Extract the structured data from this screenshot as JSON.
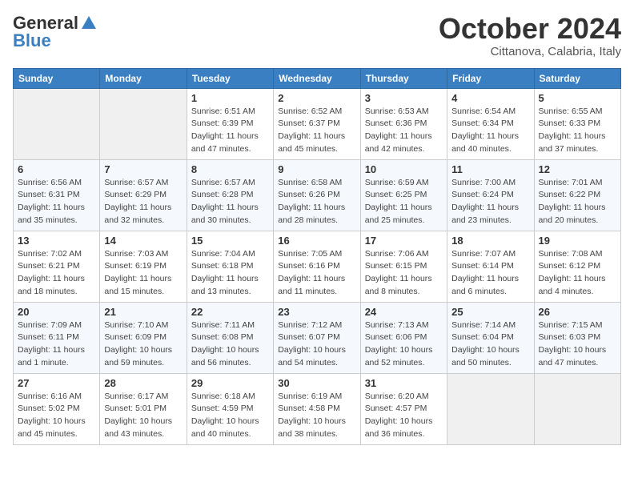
{
  "logo": {
    "general": "General",
    "blue": "Blue"
  },
  "title": "October 2024",
  "location": "Cittanova, Calabria, Italy",
  "weekdays": [
    "Sunday",
    "Monday",
    "Tuesday",
    "Wednesday",
    "Thursday",
    "Friday",
    "Saturday"
  ],
  "weeks": [
    [
      {
        "day": "",
        "sunrise": "",
        "sunset": "",
        "daylight": ""
      },
      {
        "day": "",
        "sunrise": "",
        "sunset": "",
        "daylight": ""
      },
      {
        "day": "1",
        "sunrise": "Sunrise: 6:51 AM",
        "sunset": "Sunset: 6:39 PM",
        "daylight": "Daylight: 11 hours and 47 minutes."
      },
      {
        "day": "2",
        "sunrise": "Sunrise: 6:52 AM",
        "sunset": "Sunset: 6:37 PM",
        "daylight": "Daylight: 11 hours and 45 minutes."
      },
      {
        "day": "3",
        "sunrise": "Sunrise: 6:53 AM",
        "sunset": "Sunset: 6:36 PM",
        "daylight": "Daylight: 11 hours and 42 minutes."
      },
      {
        "day": "4",
        "sunrise": "Sunrise: 6:54 AM",
        "sunset": "Sunset: 6:34 PM",
        "daylight": "Daylight: 11 hours and 40 minutes."
      },
      {
        "day": "5",
        "sunrise": "Sunrise: 6:55 AM",
        "sunset": "Sunset: 6:33 PM",
        "daylight": "Daylight: 11 hours and 37 minutes."
      }
    ],
    [
      {
        "day": "6",
        "sunrise": "Sunrise: 6:56 AM",
        "sunset": "Sunset: 6:31 PM",
        "daylight": "Daylight: 11 hours and 35 minutes."
      },
      {
        "day": "7",
        "sunrise": "Sunrise: 6:57 AM",
        "sunset": "Sunset: 6:29 PM",
        "daylight": "Daylight: 11 hours and 32 minutes."
      },
      {
        "day": "8",
        "sunrise": "Sunrise: 6:57 AM",
        "sunset": "Sunset: 6:28 PM",
        "daylight": "Daylight: 11 hours and 30 minutes."
      },
      {
        "day": "9",
        "sunrise": "Sunrise: 6:58 AM",
        "sunset": "Sunset: 6:26 PM",
        "daylight": "Daylight: 11 hours and 28 minutes."
      },
      {
        "day": "10",
        "sunrise": "Sunrise: 6:59 AM",
        "sunset": "Sunset: 6:25 PM",
        "daylight": "Daylight: 11 hours and 25 minutes."
      },
      {
        "day": "11",
        "sunrise": "Sunrise: 7:00 AM",
        "sunset": "Sunset: 6:24 PM",
        "daylight": "Daylight: 11 hours and 23 minutes."
      },
      {
        "day": "12",
        "sunrise": "Sunrise: 7:01 AM",
        "sunset": "Sunset: 6:22 PM",
        "daylight": "Daylight: 11 hours and 20 minutes."
      }
    ],
    [
      {
        "day": "13",
        "sunrise": "Sunrise: 7:02 AM",
        "sunset": "Sunset: 6:21 PM",
        "daylight": "Daylight: 11 hours and 18 minutes."
      },
      {
        "day": "14",
        "sunrise": "Sunrise: 7:03 AM",
        "sunset": "Sunset: 6:19 PM",
        "daylight": "Daylight: 11 hours and 15 minutes."
      },
      {
        "day": "15",
        "sunrise": "Sunrise: 7:04 AM",
        "sunset": "Sunset: 6:18 PM",
        "daylight": "Daylight: 11 hours and 13 minutes."
      },
      {
        "day": "16",
        "sunrise": "Sunrise: 7:05 AM",
        "sunset": "Sunset: 6:16 PM",
        "daylight": "Daylight: 11 hours and 11 minutes."
      },
      {
        "day": "17",
        "sunrise": "Sunrise: 7:06 AM",
        "sunset": "Sunset: 6:15 PM",
        "daylight": "Daylight: 11 hours and 8 minutes."
      },
      {
        "day": "18",
        "sunrise": "Sunrise: 7:07 AM",
        "sunset": "Sunset: 6:14 PM",
        "daylight": "Daylight: 11 hours and 6 minutes."
      },
      {
        "day": "19",
        "sunrise": "Sunrise: 7:08 AM",
        "sunset": "Sunset: 6:12 PM",
        "daylight": "Daylight: 11 hours and 4 minutes."
      }
    ],
    [
      {
        "day": "20",
        "sunrise": "Sunrise: 7:09 AM",
        "sunset": "Sunset: 6:11 PM",
        "daylight": "Daylight: 11 hours and 1 minute."
      },
      {
        "day": "21",
        "sunrise": "Sunrise: 7:10 AM",
        "sunset": "Sunset: 6:09 PM",
        "daylight": "Daylight: 10 hours and 59 minutes."
      },
      {
        "day": "22",
        "sunrise": "Sunrise: 7:11 AM",
        "sunset": "Sunset: 6:08 PM",
        "daylight": "Daylight: 10 hours and 56 minutes."
      },
      {
        "day": "23",
        "sunrise": "Sunrise: 7:12 AM",
        "sunset": "Sunset: 6:07 PM",
        "daylight": "Daylight: 10 hours and 54 minutes."
      },
      {
        "day": "24",
        "sunrise": "Sunrise: 7:13 AM",
        "sunset": "Sunset: 6:06 PM",
        "daylight": "Daylight: 10 hours and 52 minutes."
      },
      {
        "day": "25",
        "sunrise": "Sunrise: 7:14 AM",
        "sunset": "Sunset: 6:04 PM",
        "daylight": "Daylight: 10 hours and 50 minutes."
      },
      {
        "day": "26",
        "sunrise": "Sunrise: 7:15 AM",
        "sunset": "Sunset: 6:03 PM",
        "daylight": "Daylight: 10 hours and 47 minutes."
      }
    ],
    [
      {
        "day": "27",
        "sunrise": "Sunrise: 6:16 AM",
        "sunset": "Sunset: 5:02 PM",
        "daylight": "Daylight: 10 hours and 45 minutes."
      },
      {
        "day": "28",
        "sunrise": "Sunrise: 6:17 AM",
        "sunset": "Sunset: 5:01 PM",
        "daylight": "Daylight: 10 hours and 43 minutes."
      },
      {
        "day": "29",
        "sunrise": "Sunrise: 6:18 AM",
        "sunset": "Sunset: 4:59 PM",
        "daylight": "Daylight: 10 hours and 40 minutes."
      },
      {
        "day": "30",
        "sunrise": "Sunrise: 6:19 AM",
        "sunset": "Sunset: 4:58 PM",
        "daylight": "Daylight: 10 hours and 38 minutes."
      },
      {
        "day": "31",
        "sunrise": "Sunrise: 6:20 AM",
        "sunset": "Sunset: 4:57 PM",
        "daylight": "Daylight: 10 hours and 36 minutes."
      },
      {
        "day": "",
        "sunrise": "",
        "sunset": "",
        "daylight": ""
      },
      {
        "day": "",
        "sunrise": "",
        "sunset": "",
        "daylight": ""
      }
    ]
  ]
}
